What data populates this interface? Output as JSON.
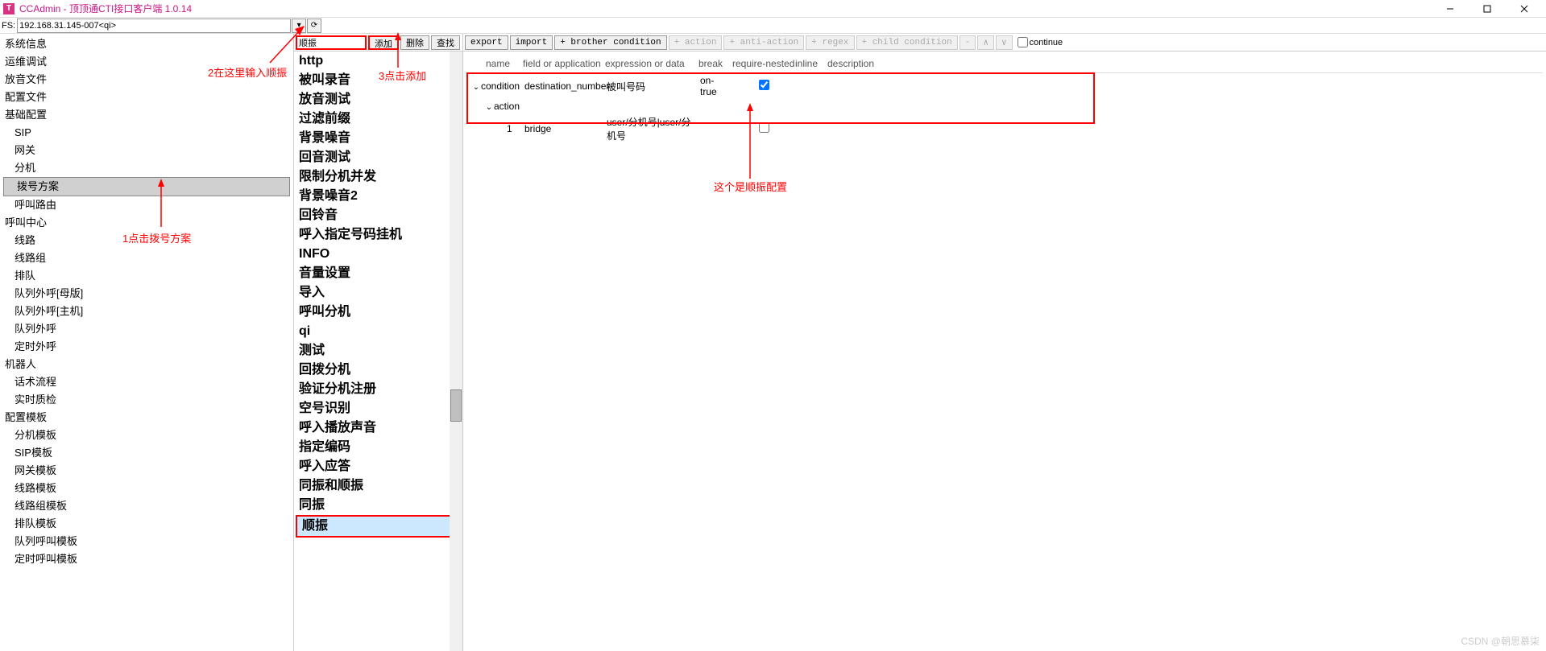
{
  "title": "CCAdmin - 顶顶通CTI接口客户端 1.0.14",
  "app_icon_letter": "T",
  "fs": {
    "label": "FS:",
    "value": "192.168.31.145-007<qi>"
  },
  "sidebar": {
    "items": [
      {
        "label": "系统信息",
        "lvl": 0
      },
      {
        "label": "运维调试",
        "lvl": 0
      },
      {
        "label": "放音文件",
        "lvl": 0
      },
      {
        "label": "配置文件",
        "lvl": 0
      },
      {
        "label": "基础配置",
        "lvl": 0
      },
      {
        "label": "SIP",
        "lvl": 1
      },
      {
        "label": "网关",
        "lvl": 1
      },
      {
        "label": "分机",
        "lvl": 1
      },
      {
        "label": "拨号方案",
        "lvl": 1,
        "selected": true
      },
      {
        "label": "呼叫路由",
        "lvl": 1
      },
      {
        "label": "呼叫中心",
        "lvl": 0
      },
      {
        "label": "线路",
        "lvl": 1
      },
      {
        "label": "线路组",
        "lvl": 1
      },
      {
        "label": "排队",
        "lvl": 1
      },
      {
        "label": "队列外呼[母版]",
        "lvl": 1
      },
      {
        "label": "队列外呼[主机]",
        "lvl": 1
      },
      {
        "label": "队列外呼",
        "lvl": 1
      },
      {
        "label": "定时外呼",
        "lvl": 1
      },
      {
        "label": "机器人",
        "lvl": 0
      },
      {
        "label": "话术流程",
        "lvl": 1
      },
      {
        "label": "实时质检",
        "lvl": 1
      },
      {
        "label": "配置模板",
        "lvl": 0
      },
      {
        "label": "分机模板",
        "lvl": 1
      },
      {
        "label": "SIP模板",
        "lvl": 1
      },
      {
        "label": "网关模板",
        "lvl": 1
      },
      {
        "label": "线路模板",
        "lvl": 1
      },
      {
        "label": "线路组模板",
        "lvl": 1
      },
      {
        "label": "排队模板",
        "lvl": 1
      },
      {
        "label": "队列呼叫模板",
        "lvl": 1
      },
      {
        "label": "定时呼叫模板",
        "lvl": 1
      }
    ]
  },
  "mid": {
    "input_value": "顺振",
    "buttons": {
      "add": "添加",
      "del": "删除",
      "find": "查找"
    },
    "items": [
      "http",
      "被叫录音",
      "放音测试",
      "过滤前缀",
      "背景噪音",
      "回音测试",
      "限制分机并发",
      "背景噪音2",
      "回铃音",
      "呼入指定号码挂机",
      "INFO",
      "音量设置",
      "导入",
      "呼叫分机",
      "qi",
      "测试",
      "回拨分机",
      "验证分机注册",
      "空号识别",
      "呼入播放声音",
      "指定编码",
      "呼入应答",
      "同振和顺振",
      "同振",
      "顺振"
    ],
    "selected_index": 24
  },
  "right": {
    "buttons": {
      "export": "export",
      "import": "import",
      "brother": "+ brother condition",
      "action": "+ action",
      "anti": "+ anti-action",
      "regex": "+ regex",
      "child": "+ child condition",
      "minus": "-",
      "up": "∧",
      "down": "∨"
    },
    "continue_label": "continue",
    "headers": {
      "name": "name",
      "field": "field or application",
      "expr": "expression or data",
      "break": "break",
      "req": "require-nested",
      "inline": "inline",
      "desc": "description"
    },
    "rows": [
      {
        "indent": 0,
        "chev": "⌄",
        "name": "condition",
        "field": "destination_number",
        "expr": "被叫号码",
        "break": "on-true",
        "checked": true
      },
      {
        "indent": 1,
        "chev": "⌄",
        "name": "action",
        "field": "",
        "expr": "",
        "break": "",
        "checked": null
      },
      {
        "indent": 2,
        "chev": "",
        "name": "1",
        "field": "bridge",
        "expr": "user/分机号|user/分机号",
        "break": "",
        "checked": false
      }
    ]
  },
  "annotations": {
    "a1": "1点击拨号方案",
    "a2": "2在这里输入顺振",
    "a3": "3点击添加",
    "a4": "这个是顺振配置"
  },
  "watermark": "CSDN @朝思慕柒"
}
